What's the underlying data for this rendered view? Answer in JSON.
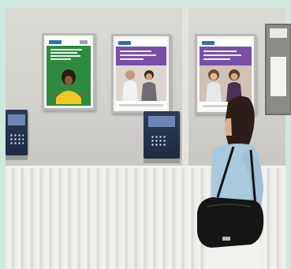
{
  "scene": {
    "description_colors": {
      "wall": "#d6d4cf",
      "frame": "#b8b8b6",
      "terminal": "#263350",
      "accent_green": "#2e8b3e",
      "accent_purple": "#7a4fa8"
    }
  },
  "posters": [
    {
      "band_color": "#2e8b3e",
      "photo_color": "#2e8b3e"
    },
    {
      "band_color": "#7a4fa8",
      "photo_color": "#cfc8c2"
    },
    {
      "band_color": "#7a4fa8",
      "photo_color": "#c9b7a6"
    }
  ]
}
